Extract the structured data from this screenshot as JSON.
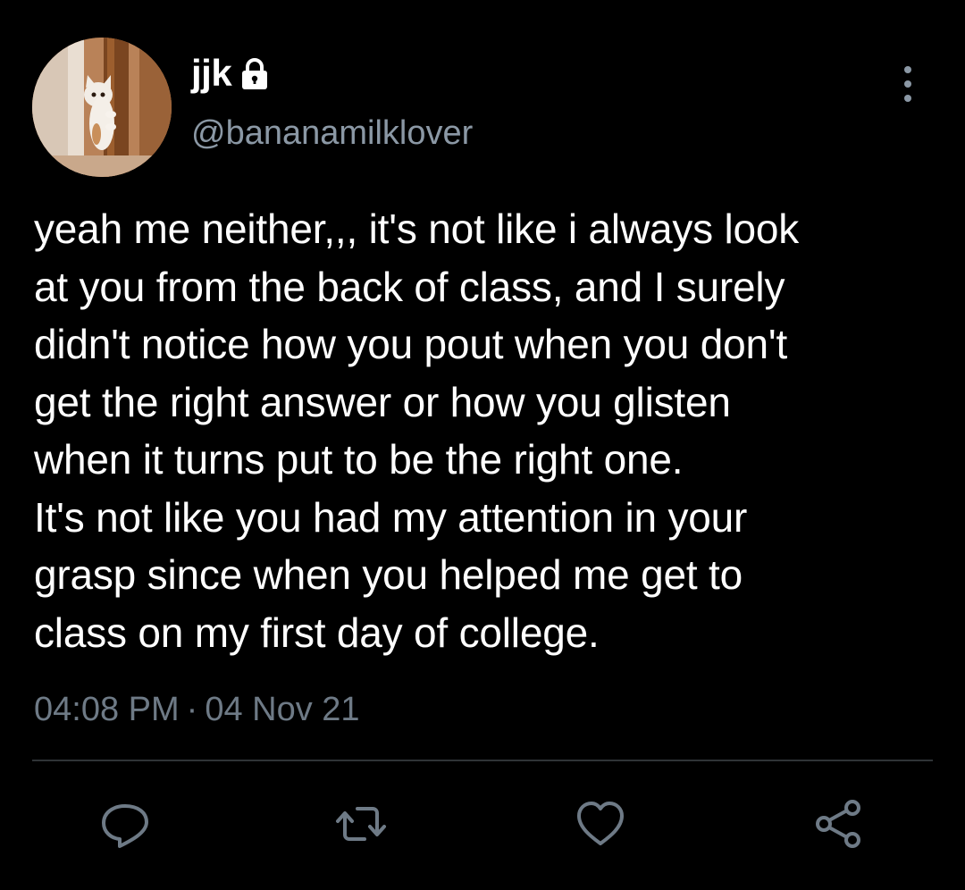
{
  "user": {
    "display_name": "jjk",
    "handle": "@bananamilklover",
    "locked_icon": "lock-icon",
    "avatar_icon": "cat-avatar"
  },
  "tweet": {
    "text": "yeah me neither,,, it's not like i always look\nat you from the back of class, and I surely\ndidn't notice how you pout when you don't\nget the right answer or how you glisten\nwhen it turns put to be the right one.\nIt's not like you had my attention in your\ngrasp since when you helped me get to\nclass on my first day of college.",
    "time": "04:08 PM",
    "separator": "·",
    "date": "04 Nov 21"
  },
  "actions": {
    "reply_icon": "reply-icon",
    "retweet_icon": "retweet-icon",
    "like_icon": "heart-icon",
    "share_icon": "share-icon",
    "more_icon": "more-vertical-icon"
  },
  "colors": {
    "background": "#000000",
    "primary_text": "#ffffff",
    "secondary_text": "#8b98a5",
    "icon": "#6e7a86",
    "divider": "#2f3336"
  }
}
